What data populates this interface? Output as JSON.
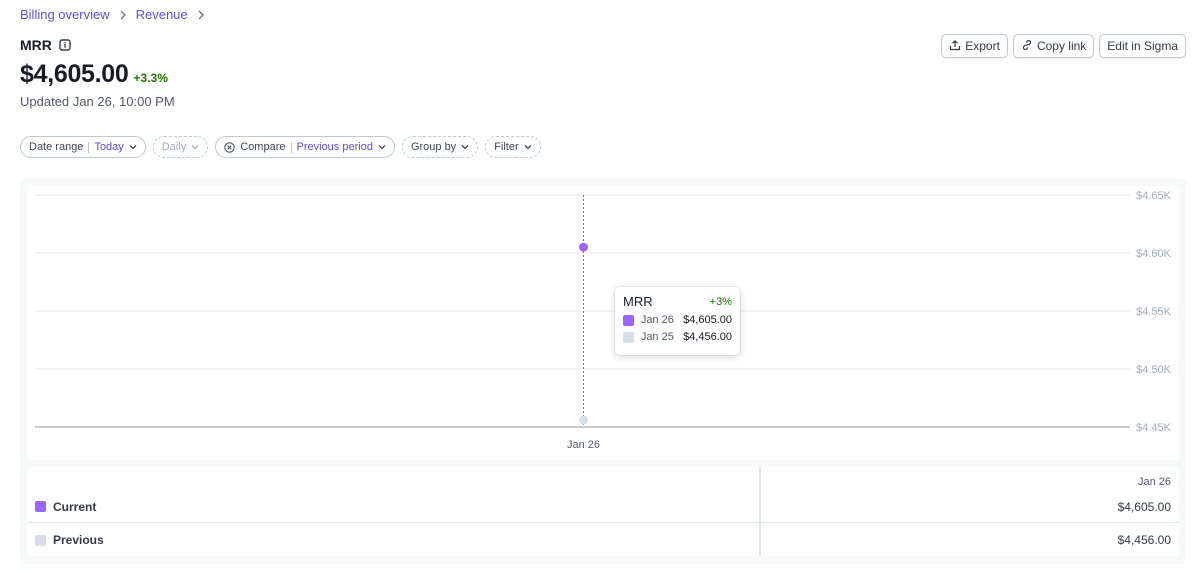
{
  "breadcrumb": [
    {
      "label": "Billing overview"
    },
    {
      "label": "Revenue"
    }
  ],
  "header": {
    "title": "MRR",
    "value": "$4,605.00",
    "delta": "+3.3%",
    "updated": "Updated Jan 26, 10:00 PM"
  },
  "actions": {
    "export": "Export",
    "copy_link": "Copy link",
    "edit": "Edit in Sigma"
  },
  "filters": {
    "date_range_label": "Date range",
    "date_range_value": "Today",
    "interval": "Daily",
    "compare_label": "Compare",
    "compare_value": "Previous period",
    "group_by": "Group by",
    "filter": "Filter"
  },
  "colors": {
    "current": "#9966ff",
    "previous": "#d8dee4",
    "link": "#5b4fe0",
    "positive": "#217005"
  },
  "chart_data": {
    "type": "line",
    "x": [
      "Jan 26"
    ],
    "series": [
      {
        "name": "Current",
        "values": [
          4605.0
        ]
      },
      {
        "name": "Previous",
        "values": [
          4456.0
        ]
      }
    ],
    "ylim": [
      4450,
      4650
    ],
    "yticks": [
      "$4.65K",
      "$4.60K",
      "$4.55K",
      "$4.50K",
      "$4.45K"
    ],
    "grid": true
  },
  "tooltip": {
    "title": "MRR",
    "delta": "+3%",
    "rows": [
      {
        "date": "Jan 26",
        "value": "$4,605.00"
      },
      {
        "date": "Jan 25",
        "value": "$4,456.00"
      }
    ]
  },
  "table": {
    "column": "Jan 26",
    "rows": [
      {
        "name": "Current",
        "value": "$4,605.00"
      },
      {
        "name": "Previous",
        "value": "$4,456.00"
      }
    ]
  }
}
